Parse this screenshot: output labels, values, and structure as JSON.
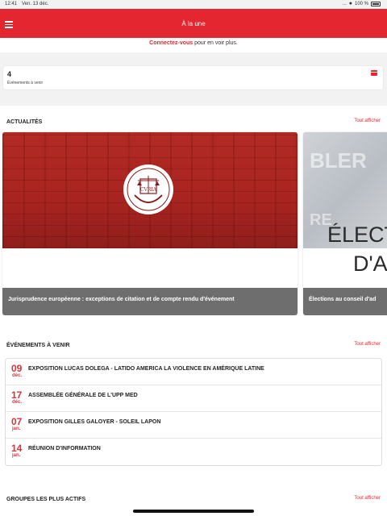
{
  "status_bar": {
    "time": "12:41",
    "date": "Ven. 13 déc.",
    "dots": "...",
    "battery": "100 %"
  },
  "header": {
    "title": "À la une"
  },
  "login": {
    "link": "Connectez-vous",
    "text": " pour en voir plus."
  },
  "stats": {
    "count": "4",
    "label": "Événements à venir"
  },
  "news": {
    "title": "ACTUALITÉS",
    "show_all": "Tout afficher",
    "cards": [
      {
        "caption": "Jurisprudence européenne : exceptions de citation et de compte rendu d'événement",
        "emblem_text": "CVRIA"
      },
      {
        "caption": "Élections au conseil d'ad",
        "img_line1": "ÉLECT",
        "img_line2": "D'AI",
        "ghost1": "BLER",
        "ghost2": "RE"
      }
    ]
  },
  "events": {
    "title": "ÉVÉNEMENTS À VENIR",
    "show_all": "Tout afficher",
    "items": [
      {
        "day": "09",
        "month": "déc.",
        "name": "EXPOSITION LUCAS DOLEGA - LATIDO AMERICA LA VIOLENCE EN AMÉRIQUE LATINE"
      },
      {
        "day": "17",
        "month": "déc.",
        "name": "ASSEMBLÉE GÉNÉRALE DE L'UPP MED"
      },
      {
        "day": "07",
        "month": "jan.",
        "name": "EXPOSITION GILLES GALOYER - SOLEIL LAPON"
      },
      {
        "day": "14",
        "month": "jan.",
        "name": "RÉUNION D'INFORMATION"
      }
    ]
  },
  "groups": {
    "title": "GROUPES LES PLUS ACTIFS",
    "show_all": "Tout afficher"
  },
  "colors": {
    "accent": "#e3262f",
    "caption_bg": "#6e6e6e"
  }
}
